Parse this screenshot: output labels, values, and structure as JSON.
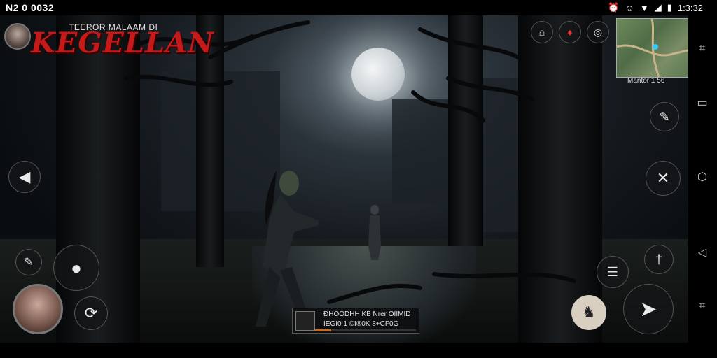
{
  "status_bar": {
    "left_text": "N2 0 0032",
    "time": "1:3:32",
    "icons": [
      "alarm-icon",
      "cat-icon",
      "wifi-icon",
      "signal-icon",
      "battery-icon"
    ]
  },
  "game": {
    "title_small": "TEEROR MALAAM DI",
    "title_big": "KEGELLAN"
  },
  "minimap": {
    "label": "Mantor 1 56"
  },
  "weapon_panel": {
    "line1": "ĐHOODHH KB Nrer OIIMID",
    "line2": "IEGI0 1 ©I®0K 8+CF0G",
    "progress": 0.16,
    "progress_color": "#d06a1a"
  },
  "controls": {
    "left": [
      "back-arrow-icon",
      "knife-icon",
      "grenade-icon",
      "reload-icon"
    ],
    "right": [
      "knife-icon",
      "crossed-weapons-icon",
      "sword-icon",
      "inventory-icon",
      "attack-icon",
      "character-icon"
    ],
    "top": [
      "home-icon",
      "alert-icon",
      "target-icon"
    ]
  },
  "nav": [
    "crop-icon",
    "square-icon",
    "home-outline-icon",
    "back-triangle-icon",
    "expand-icon"
  ],
  "colors": {
    "title_red": "#c41a1a",
    "scene_dark": "#0a0d10"
  }
}
